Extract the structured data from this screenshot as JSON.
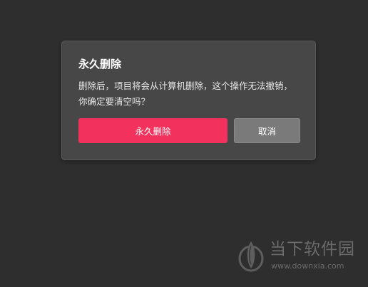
{
  "dialog": {
    "title": "永久删除",
    "message": "删除后，项目将会从计算机删除，这个操作无法撤销，你确定要清空吗？",
    "confirm_label": "永久删除",
    "cancel_label": "取消"
  },
  "watermark": {
    "name": "当下软件园",
    "url": "www.downxia.com"
  },
  "colors": {
    "background": "#2e2e2e",
    "dialog": "#474747",
    "confirm": "#f2325c",
    "cancel": "#7a7a7a"
  }
}
